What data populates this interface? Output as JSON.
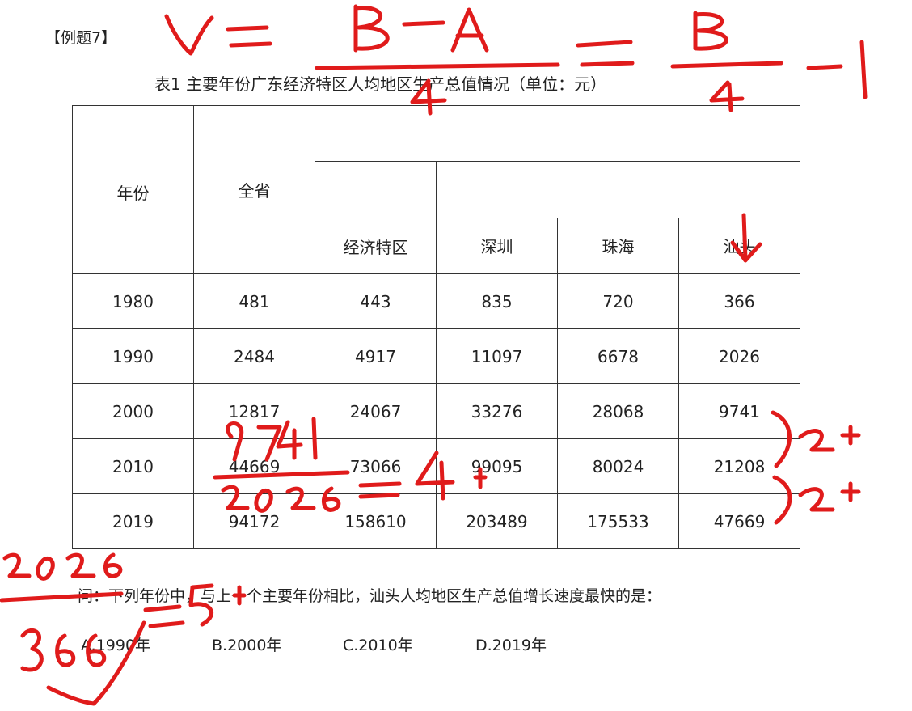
{
  "example_label": "【例题7】",
  "table_caption": "表1  主要年份广东经济特区人均地区生产总值情况（单位：元）",
  "table": {
    "headers": {
      "year": "年份",
      "province": "全省",
      "zone": "经济特区",
      "shenzhen": "深圳",
      "zhuhai": "珠海",
      "shantou": "汕头"
    },
    "rows": [
      [
        "1980",
        "481",
        "443",
        "835",
        "720",
        "366"
      ],
      [
        "1990",
        "2484",
        "4917",
        "11097",
        "6678",
        "2026"
      ],
      [
        "2000",
        "12817",
        "24067",
        "33276",
        "28068",
        "9741"
      ],
      [
        "2010",
        "44669",
        "73066",
        "99095",
        "80024",
        "21208"
      ],
      [
        "2019",
        "94172",
        "158610",
        "203489",
        "175533",
        "47669"
      ]
    ]
  },
  "question": "问：下列年份中，与上一个主要年份相比，汕头人均地区生产总值增长速度最快的是：",
  "options": [
    "A.1990年",
    "B.2000年",
    "C.2010年",
    "D.2019年"
  ],
  "handwriting": {
    "color": "#e01b1b",
    "formula": "r = (B−A)/A = B/A − 1",
    "note_2000": "9741 / 2026 = 4+",
    "note_1990": "2026 / 366 = 5+",
    "mark_2010": "2+",
    "mark_2019": "2+"
  }
}
